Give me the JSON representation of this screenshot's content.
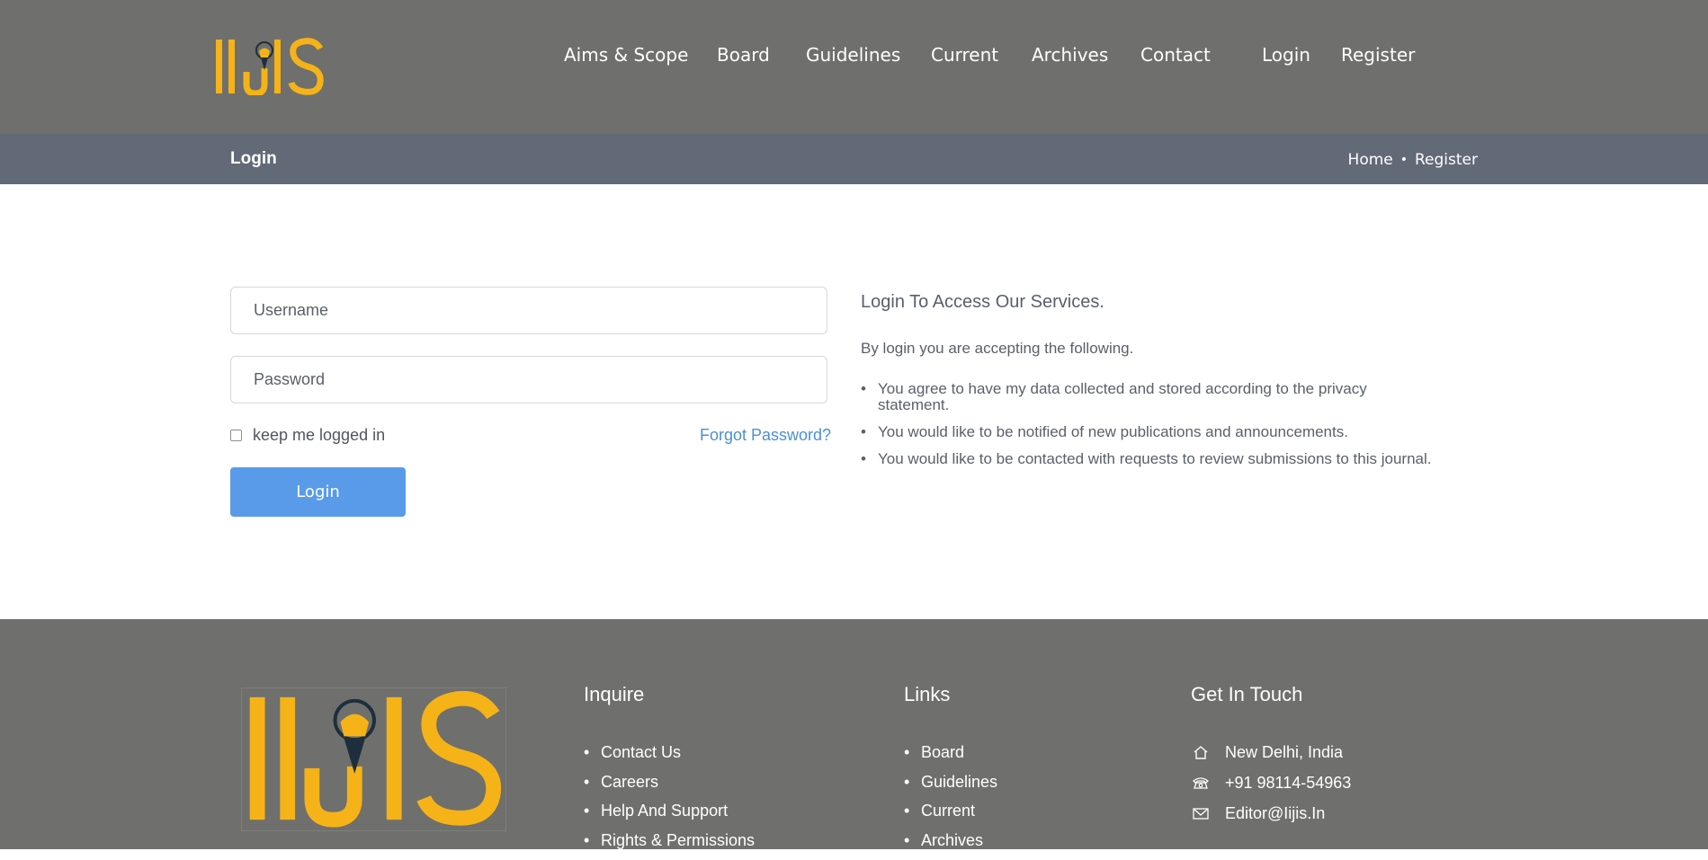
{
  "brand": {
    "logo_text": "IIJIS",
    "logo_color": "#f5b318",
    "logo_dark": "#1e2e3c"
  },
  "nav": {
    "items": [
      "Aims & Scope",
      "Board",
      "Guidelines",
      "Current",
      "Archives",
      "Contact",
      "Login",
      "Register"
    ]
  },
  "subheader": {
    "title": "Login",
    "breadcrumb": [
      "Home",
      "Register"
    ],
    "separator": "•"
  },
  "form": {
    "username_placeholder": "Username",
    "password_placeholder": "Password",
    "remember_label": "keep me logged in",
    "forgot_label": "Forgot Password?",
    "submit_label": "Login"
  },
  "info": {
    "title": "Login To Access Our Services.",
    "intro": "By login you are accepting the following.",
    "items": [
      "You agree to have my data collected and stored according to the privacy statement.",
      "You would like to be notified of new publications and announcements.",
      "You would like to be contacted with requests to review submissions to this journal."
    ]
  },
  "footer": {
    "inquire": {
      "heading": "Inquire",
      "items": [
        "Contact Us",
        "Careers",
        "Help And Support",
        "Rights & Permissions"
      ]
    },
    "links": {
      "heading": "Links",
      "items": [
        "Board",
        "Guidelines",
        "Current",
        "Archives"
      ]
    },
    "contact": {
      "heading": "Get In Touch",
      "address": "New Delhi, India",
      "phone": "+91 98114-54963",
      "email": "Editor@Iijis.In"
    }
  },
  "colors": {
    "header_bg": "#6f6f6d",
    "subheader_bg": "#616a76",
    "accent": "#5a9be9",
    "link": "#4a8fd9"
  }
}
